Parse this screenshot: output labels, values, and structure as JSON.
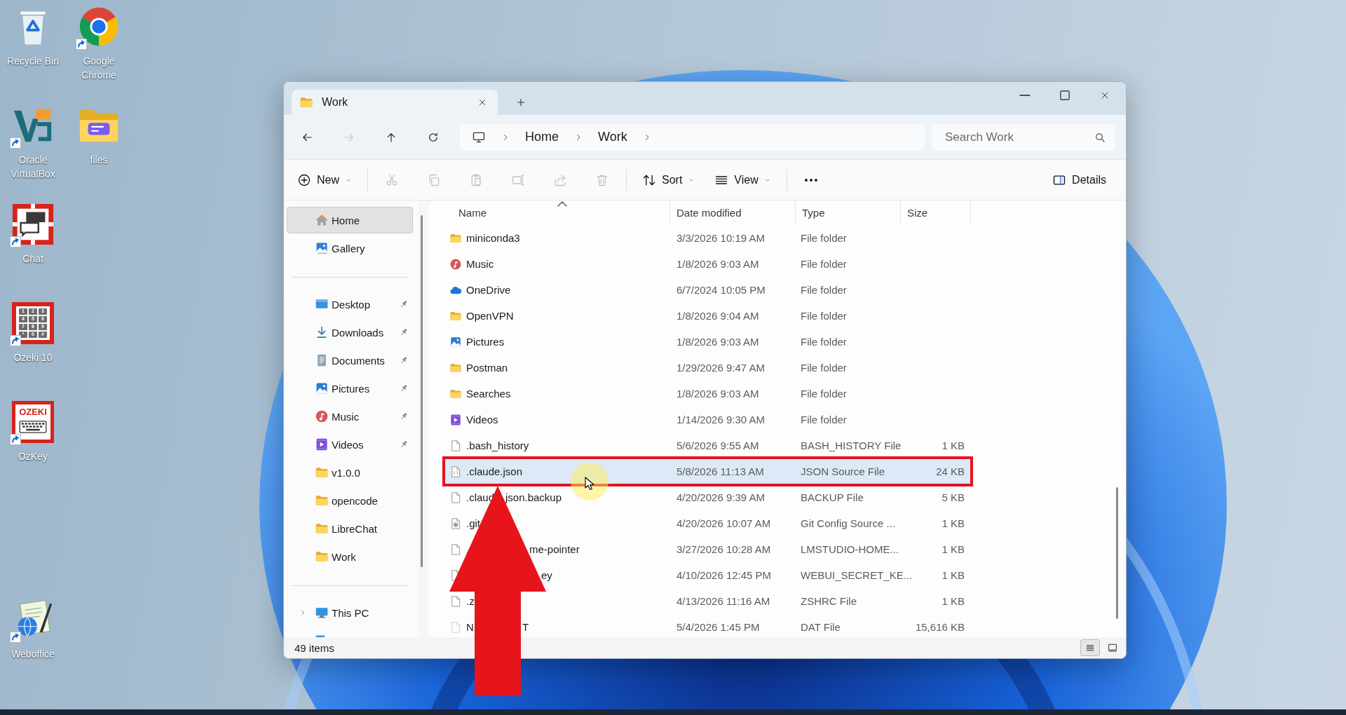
{
  "desktop_icons": [
    {
      "label": "Recycle Bin",
      "kind": "recycle-bin",
      "shortcut": false
    },
    {
      "label": "Google Chrome",
      "kind": "browser",
      "shortcut": true
    },
    {
      "label": "Oracle VirtualBox",
      "kind": "virtualization",
      "shortcut": true
    },
    {
      "label": "files",
      "kind": "chat-folder",
      "shortcut": false
    },
    {
      "label": "Chat",
      "kind": "chat",
      "shortcut": true
    },
    {
      "label": "Ozeki 10",
      "kind": "keypad",
      "shortcut": true,
      "keys": [
        "1",
        "2",
        "3",
        "4",
        "5",
        "6",
        "7",
        "8",
        "9",
        "*",
        "0",
        "#"
      ]
    },
    {
      "label": "OzKey",
      "kind": "keyboard",
      "shortcut": true,
      "logo_text": "OZEKI"
    },
    {
      "label": "Weboffice",
      "kind": "web-office",
      "shortcut": true
    }
  ],
  "window": {
    "tabs": [
      {
        "title": "Work",
        "selected": true
      }
    ],
    "nav_buttons": [
      {
        "kind": "back",
        "disabled": false
      },
      {
        "kind": "forward",
        "disabled": true
      },
      {
        "kind": "up",
        "disabled": false
      },
      {
        "kind": "refresh",
        "disabled": false
      }
    ],
    "breadcrumb": [
      "Home",
      "Work"
    ],
    "search": {
      "placeholder": "Search Work"
    },
    "toolbar": [
      {
        "kind": "new",
        "label": "New",
        "disabled": false
      },
      {
        "kind": "cut",
        "disabled": true
      },
      {
        "kind": "copy",
        "disabled": true
      },
      {
        "kind": "paste",
        "disabled": true
      },
      {
        "kind": "rename",
        "disabled": true
      },
      {
        "kind": "share",
        "disabled": true
      },
      {
        "kind": "delete",
        "disabled": true
      },
      {
        "kind": "sort",
        "label": "Sort",
        "disabled": false
      },
      {
        "kind": "view",
        "label": "View",
        "disabled": false
      },
      {
        "kind": "more",
        "disabled": false
      }
    ],
    "details_button": {
      "label": "Details"
    },
    "sidebar": [
      {
        "items": [
          {
            "label": "Home",
            "kind": "home",
            "selected": true
          },
          {
            "label": "Gallery",
            "kind": "gallery",
            "selected": false
          }
        ]
      },
      {
        "items": [
          {
            "label": "Desktop",
            "kind": "desktop",
            "selected": false,
            "pinned": true
          },
          {
            "label": "Downloads",
            "kind": "downloads",
            "selected": false,
            "pinned": true
          },
          {
            "label": "Documents",
            "kind": "documents",
            "selected": false,
            "pinned": true
          },
          {
            "label": "Pictures",
            "kind": "pictures",
            "selected": false,
            "pinned": true
          },
          {
            "label": "Music",
            "kind": "music",
            "selected": false,
            "pinned": true
          },
          {
            "label": "Videos",
            "kind": "videos",
            "selected": false,
            "pinned": true
          },
          {
            "label": "v1.0.0",
            "kind": "folder",
            "selected": false,
            "pinned": false
          },
          {
            "label": "opencode",
            "kind": "folder",
            "selected": false,
            "pinned": false
          },
          {
            "label": "LibreChat",
            "kind": "folder",
            "selected": false,
            "pinned": false
          },
          {
            "label": "Work",
            "kind": "folder",
            "selected": false,
            "pinned": false
          }
        ]
      },
      {
        "items": [
          {
            "label": "This PC",
            "kind": "pc",
            "selected": false,
            "expanded": false
          },
          {
            "kind": "network",
            "selected": false
          }
        ]
      }
    ],
    "columns": [
      {
        "label": "Name",
        "sorted": true
      },
      {
        "label": "Date modified",
        "sorted": false
      },
      {
        "label": "Type",
        "sorted": false
      },
      {
        "label": "Size",
        "sorted": false
      }
    ],
    "rows": [
      {
        "kind": "folder",
        "name": "miniconda3",
        "date": "3/3/2026 10:19 AM",
        "type": "File folder",
        "selected": false,
        "framed": false,
        "hidden": false
      },
      {
        "kind": "music",
        "name": "Music",
        "date": "1/8/2026 9:03 AM",
        "type": "File folder",
        "selected": false,
        "framed": false,
        "hidden": false
      },
      {
        "kind": "onedrive",
        "name": "OneDrive",
        "date": "6/7/2024 10:05 PM",
        "type": "File folder",
        "selected": false,
        "framed": false,
        "hidden": false
      },
      {
        "kind": "folder",
        "name": "OpenVPN",
        "date": "1/8/2026 9:04 AM",
        "type": "File folder",
        "selected": false,
        "framed": false,
        "hidden": false
      },
      {
        "kind": "pictures",
        "name": "Pictures",
        "date": "1/8/2026 9:03 AM",
        "type": "File folder",
        "selected": false,
        "framed": false,
        "hidden": false
      },
      {
        "kind": "folder",
        "name": "Postman",
        "date": "1/29/2026 9:47 AM",
        "type": "File folder",
        "selected": false,
        "framed": false,
        "hidden": false
      },
      {
        "kind": "folder",
        "name": "Searches",
        "date": "1/8/2026 9:03 AM",
        "type": "File folder",
        "selected": false,
        "framed": false,
        "hidden": false
      },
      {
        "kind": "videos",
        "name": "Videos",
        "date": "1/14/2026 9:30 AM",
        "type": "File folder",
        "selected": false,
        "framed": false,
        "hidden": false
      },
      {
        "kind": "file",
        "name": ".bash_history",
        "date": "5/6/2026 9:55 AM",
        "type": "BASH_HISTORY File",
        "size": "1 KB",
        "selected": false,
        "framed": false,
        "hidden": false
      },
      {
        "kind": "json",
        "name": ".claude.json",
        "date": "5/8/2026 11:13 AM",
        "type": "JSON Source File",
        "size": "24 KB",
        "selected": true,
        "framed": true,
        "hidden": false
      },
      {
        "kind": "file",
        "name": ".claud",
        "name_past_arrow": "json.backup",
        "date": "4/20/2026 9:39 AM",
        "type": "BACKUP File",
        "size": "5 KB",
        "selected": false,
        "framed": false,
        "hidden": false
      },
      {
        "kind": "config",
        "name": ".git",
        "date": "4/20/2026 10:07 AM",
        "type": "Git Config Source ...",
        "size": "1 KB",
        "selected": false,
        "framed": false,
        "hidden": false
      },
      {
        "kind": "file",
        "name": ".",
        "name_past_arrow": "me-pointer",
        "date": "3/27/2026 10:28 AM",
        "type": "LMSTUDIO-HOME...",
        "size": "1 KB",
        "selected": false,
        "framed": false,
        "hidden": false
      },
      {
        "kind": "file",
        "name_past_arrow": "ey",
        "date": "4/10/2026 12:45 PM",
        "type": "WEBUI_SECRET_KE...",
        "size": "1 KB",
        "selected": false,
        "framed": false,
        "hidden": false
      },
      {
        "kind": "file",
        "name": ".z",
        "date": "4/13/2026 11:16 AM",
        "type": "ZSHRC File",
        "size": "1 KB",
        "selected": false,
        "framed": false,
        "hidden": false
      },
      {
        "kind": "file",
        "name": "N",
        "name_past_arrow": "T",
        "date": "5/4/2026 1:45 PM",
        "type": "DAT File",
        "size": "15,616 KB",
        "selected": false,
        "framed": false,
        "hidden": true
      }
    ],
    "status_bar": {
      "count": "49 items",
      "views": [
        {
          "kind": "details",
          "selected": true
        },
        {
          "kind": "tiles",
          "selected": false
        }
      ]
    }
  }
}
